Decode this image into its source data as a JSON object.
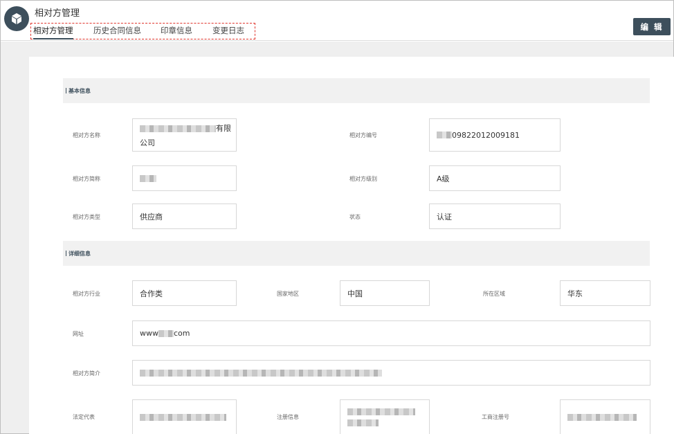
{
  "header": {
    "title": "相对方管理",
    "tabs": [
      {
        "label": "相对方管理"
      },
      {
        "label": "历史合同信息"
      },
      {
        "label": "印章信息"
      },
      {
        "label": "变更日志"
      }
    ],
    "edit_label": "编 辑",
    "logo_icon": "cube-icon"
  },
  "sections": {
    "basic": "基本信息",
    "detail": "详细信息"
  },
  "basic": {
    "name_label": "相对方名称",
    "name_value_line1_suffix": "有限",
    "name_value_line2": "公司",
    "code_label": "相对方编号",
    "code_value": "09822012009181",
    "short_label": "相对方简称",
    "level_label": "相对方级别",
    "level_value": "A级",
    "type_label": "相对方类型",
    "type_value": "供应商",
    "status_label": "状态",
    "status_value": "认证"
  },
  "detail": {
    "industry_label": "相对方行业",
    "industry_value": "合作类",
    "country_label": "国家地区",
    "country_value": "中国",
    "region_label": "所在区域",
    "region_value": "华东",
    "website_label": "网址",
    "website_prefix": "www",
    "website_suffix": "com",
    "intro_label": "相对方简介",
    "legal_label": "法定代表",
    "reg_label": "注册信息",
    "biz_label": "工商注册号"
  },
  "colors": {
    "primary": "#3d4f5c",
    "highlight": "#e0322a"
  }
}
